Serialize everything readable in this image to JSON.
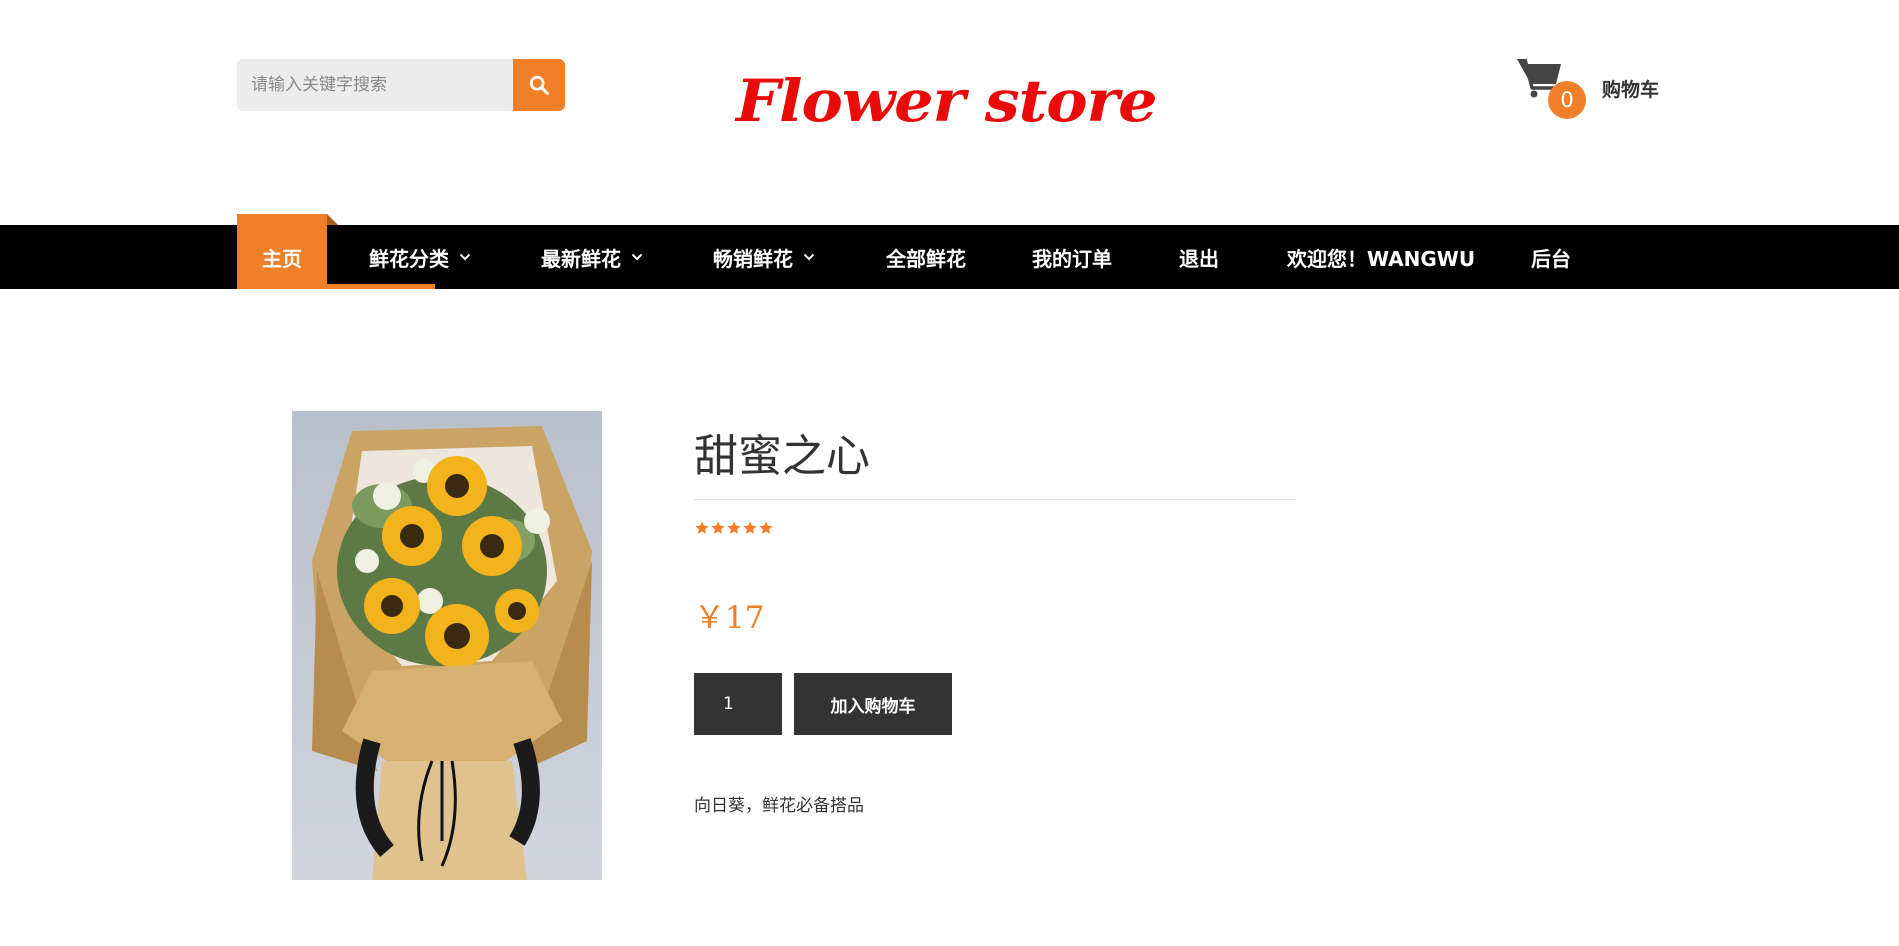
{
  "header": {
    "search": {
      "placeholder": "请输入关键字搜索",
      "value": "",
      "button_icon": "search-icon"
    },
    "logo_text": "Flower store",
    "cart": {
      "icon": "shopping-cart-icon",
      "count": "0",
      "label": "购物车"
    }
  },
  "nav": {
    "items": [
      {
        "label": "主页",
        "active": true
      },
      {
        "label": "鲜花分类",
        "dropdown": true
      },
      {
        "label": "最新鲜花",
        "dropdown": true
      },
      {
        "label": "畅销鲜花",
        "dropdown": true
      },
      {
        "label": "全部鲜花"
      },
      {
        "label": "我的订单"
      },
      {
        "label": "退出"
      },
      {
        "label": "欢迎您！WANGWU"
      },
      {
        "label": "后台"
      }
    ]
  },
  "product": {
    "image_alt": "sunflower-bouquet",
    "title": "甜蜜之心",
    "rating": 5,
    "rating_max": 5,
    "price": "￥17",
    "quantity": "1",
    "add_to_cart_label": "加入购物车",
    "description": "向日葵，鲜花必备搭品"
  },
  "colors": {
    "accent": "#f07f2a",
    "logo": "#ea0a0a",
    "nav_bg": "#000000",
    "button_bg": "#333333"
  }
}
